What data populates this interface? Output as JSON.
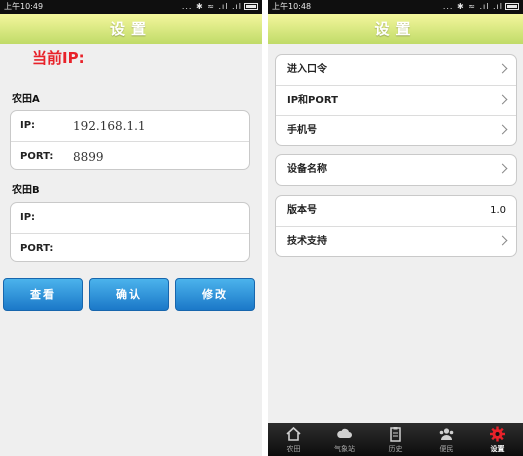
{
  "left": {
    "status": {
      "time": "上午10:49",
      "icons": "... ✱ ≈ .ıl .ıl"
    },
    "title": "设置",
    "current_ip_label": "当前IP:",
    "group_a": {
      "label": "农田A",
      "ip_label": "IP:",
      "ip_value": "192.168.1.1",
      "port_label": "PORT:",
      "port_value": "8899"
    },
    "group_b": {
      "label": "农田B",
      "ip_label": "IP:",
      "ip_value": "",
      "port_label": "PORT:",
      "port_value": ""
    },
    "buttons": {
      "view": "查看",
      "confirm": "确认",
      "modify": "修改"
    }
  },
  "right": {
    "status": {
      "time": "上午10:48",
      "icons": "... ✱ ≈ .ıl .ıl"
    },
    "title": "设置",
    "menu": {
      "enter_password": "进入口令",
      "ip_port": "IP和PORT",
      "phone": "手机号",
      "device_name": "设备名称",
      "version_label": "版本号",
      "version_value": "1.0",
      "tech_support": "技术支持"
    },
    "tabs": [
      "农田",
      "气象站",
      "历史",
      "便民",
      "设置"
    ],
    "active_tab": "设置",
    "active_tab_color": "#e8222a"
  },
  "colors": {
    "accent_button": "#2a8fdb",
    "title_bar": "#d8e87e",
    "current_ip_text": "#e8222a"
  }
}
